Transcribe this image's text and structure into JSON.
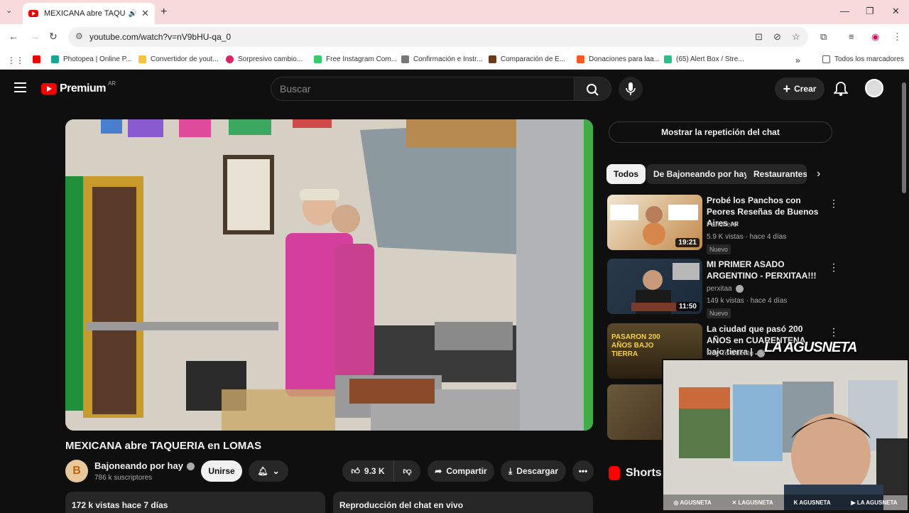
{
  "browser": {
    "tab_title": "MEXICANA abre TAQUERIA",
    "url": "youtube.com/watch?v=nV9bHU-qa_0",
    "bookmarks": [
      {
        "label": "Photopea | Online P...",
        "color": "#18a497"
      },
      {
        "label": "Convertidor de yout...",
        "color": "#f5c542"
      },
      {
        "label": "Sorpresivo cambio...",
        "color": "#e0245e"
      },
      {
        "label": "Free Instagram Com...",
        "color": "#33cc66"
      },
      {
        "label": "Confirmación e Instr...",
        "color": "#777777"
      },
      {
        "label": "Comparación de E...",
        "color": "#6b3a1a"
      },
      {
        "label": "Donaciones para laa...",
        "color": "#ff5722"
      },
      {
        "label": "(65) Alert Box / Stre...",
        "color": "#2bbf8a"
      }
    ],
    "all_bookmarks": "Todos los marcadores"
  },
  "youtube": {
    "brand": "Premium",
    "region": "AR",
    "search_placeholder": "Buscar",
    "create_label": "Crear"
  },
  "video": {
    "title": "MEXICANA abre TAQUERIA en LOMAS",
    "channel_initial": "B",
    "channel": "Bajoneando por hay",
    "subscribers": "786 k suscriptores",
    "join_label": "Unirse",
    "likes": "9.3 K",
    "share_label": "Compartir",
    "download_label": "Descargar",
    "views": "172 k vistas  hace 7 días",
    "chat_replay": "Reproducción del chat en vivo"
  },
  "sidebar": {
    "show_chat": "Mostrar la repetición del chat",
    "chips": [
      "Todos",
      "De Bajoneando por hay",
      "Restaurantes"
    ],
    "recs": [
      {
        "title": "Probé los Panchos con Peores Reseñas de Buenos Aires",
        "tag": "AR",
        "channel": "Panchero",
        "meta": "5.9 K vistas · hace 4 días",
        "badge": "Nuevo",
        "duration": "19:21"
      },
      {
        "title": "MI PRIMER ASADO ARGENTINO - PERXITAA!!!",
        "channel": "perxitaa",
        "meta": "149 k vistas · hace 4 días",
        "badge": "Nuevo",
        "duration": "11:50"
      },
      {
        "title": "La ciudad que pasó 200 AÑOS en CUARENTENA bajo tierra | ...",
        "channel": "Hoy Te Cuento",
        "thumb_text": "PASARON 200 AÑOS BAJO TIERRA"
      }
    ],
    "shorts": "Shorts"
  },
  "overlay": {
    "logo": "LA AGUSNETA",
    "socials": [
      "AGUSNETA",
      "LAGUSNETA",
      "AGUSNETA",
      "LA AGUSNETA"
    ]
  }
}
